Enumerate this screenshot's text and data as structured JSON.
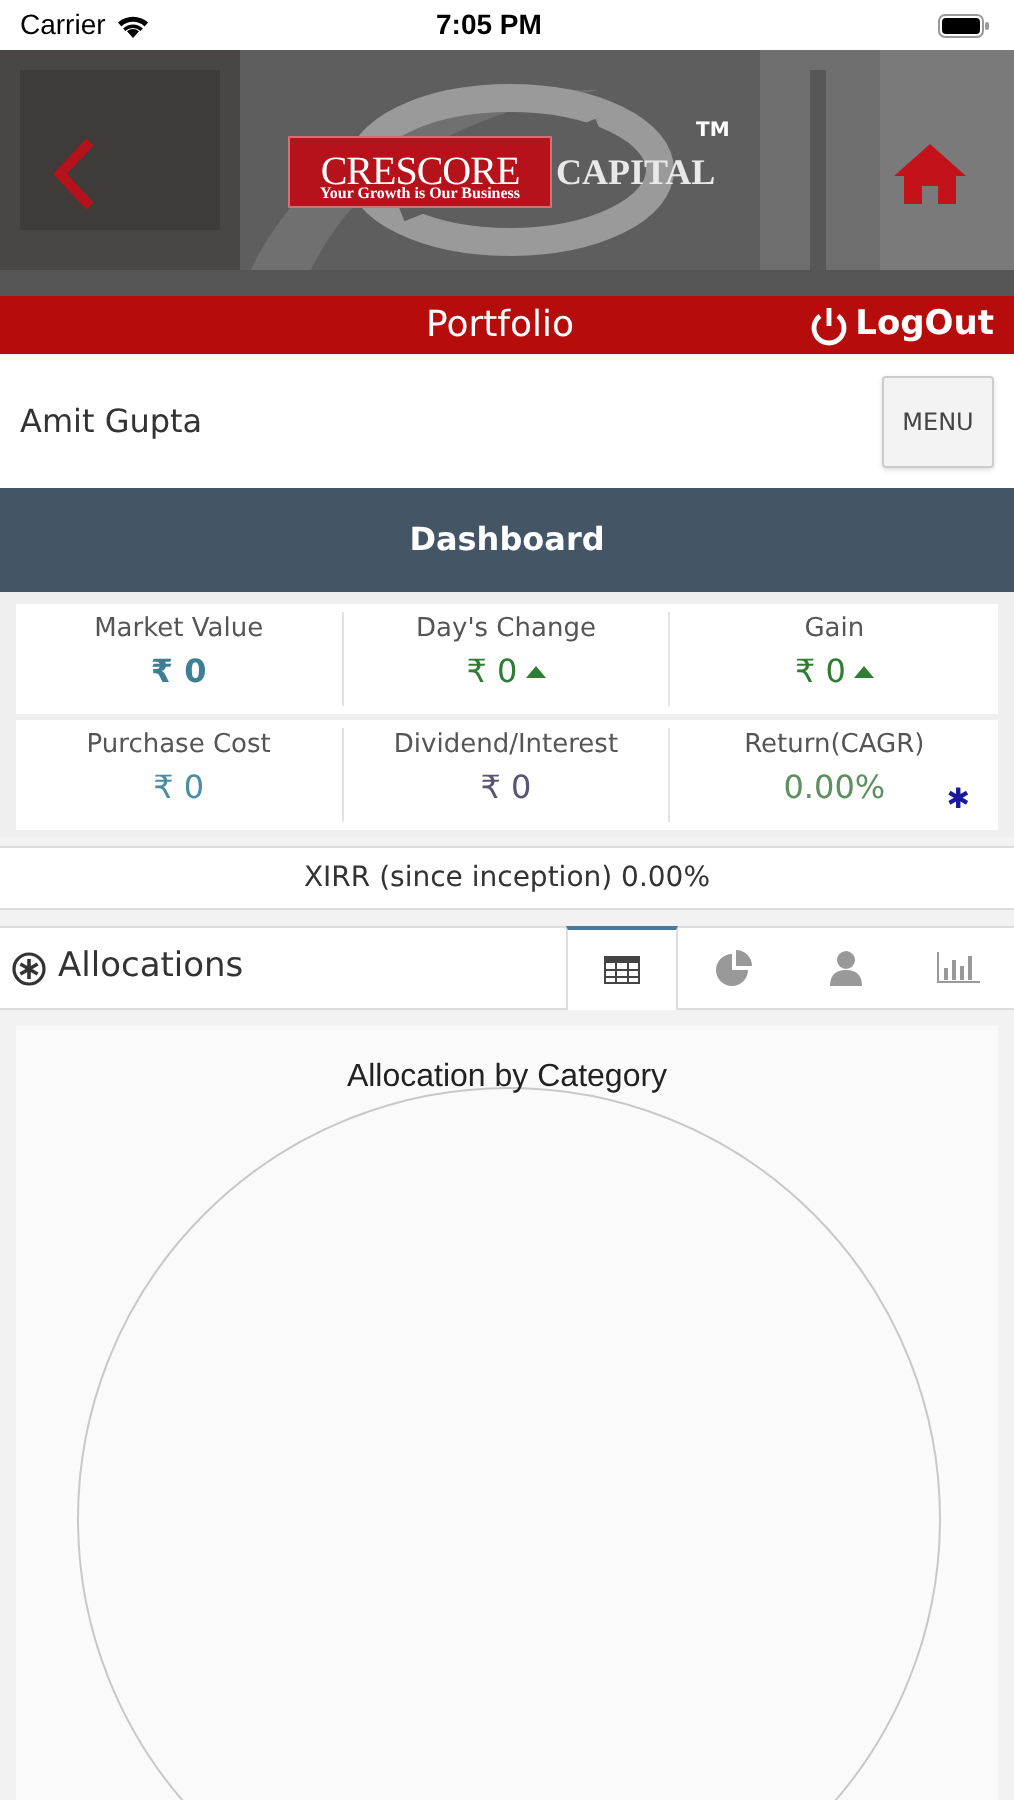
{
  "status_bar": {
    "carrier": "Carrier",
    "time": "7:05 PM"
  },
  "header": {
    "logo": {
      "name": "CRESCORE",
      "tagline": "Your Growth is Our Business",
      "suffix": "CAPITAL",
      "trademark": "TM"
    }
  },
  "title_bar": {
    "title": "Portfolio",
    "logout": "LogOut"
  },
  "user": {
    "name": "Amit Gupta",
    "menu": "MENU"
  },
  "section_title": "Dashboard",
  "stats": [
    {
      "label": "Market Value",
      "value": "₹ 0",
      "color": "#3f7f96",
      "bold": true,
      "kind": "plain"
    },
    {
      "label": "Day's Change",
      "value": "₹ 0",
      "color": "#2e7d32",
      "bold": false,
      "kind": "rising"
    },
    {
      "label": "Gain",
      "value": "₹ 0",
      "color": "#2e7d32",
      "bold": false,
      "kind": "rising"
    },
    {
      "label": "Purchase Cost",
      "value": "₹ 0",
      "color": "#4a8ea3",
      "bold": false,
      "kind": "plain"
    },
    {
      "label": "Dividend/Interest",
      "value": "₹ 0",
      "color": "#5c5470",
      "bold": false,
      "kind": "plain"
    },
    {
      "label": "Return(CAGR)",
      "value": "0.00%",
      "color": "#5e8f5e",
      "bold": false,
      "kind": "plain",
      "asterisk": "✱"
    }
  ],
  "xirr": "XIRR (since inception) 0.00%",
  "allocations": {
    "title": "Allocations",
    "tabs": [
      {
        "kind": "table",
        "selected": true
      },
      {
        "kind": "pie",
        "selected": false
      },
      {
        "kind": "person",
        "selected": false
      },
      {
        "kind": "bars",
        "selected": false
      }
    ]
  },
  "chart": {
    "title": "Allocation by Category"
  }
}
